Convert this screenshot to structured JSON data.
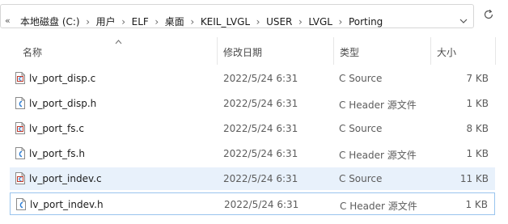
{
  "address_bar": {
    "overflow_glyph": "«",
    "separator": "›",
    "crumbs": [
      "本地磁盘 (C:)",
      "用户",
      "ELF",
      "桌面",
      "KEIL_LVGL",
      "USER",
      "LVGL",
      "Porting"
    ]
  },
  "columns": {
    "name": "名称",
    "date": "修改日期",
    "type": "类型",
    "size": "大小",
    "sorted_by": "名称"
  },
  "files": [
    {
      "name": "lv_port_disp.c",
      "date": "2022/5/24 6:31",
      "type": "C Source",
      "size": "7 KB",
      "icon": "c-source-file-icon"
    },
    {
      "name": "lv_port_disp.h",
      "date": "2022/5/24 6:31",
      "type": "C Header 源文件",
      "size": "1 KB",
      "icon": "c-header-file-icon"
    },
    {
      "name": "lv_port_fs.c",
      "date": "2022/5/24 6:31",
      "type": "C Source",
      "size": "8 KB",
      "icon": "c-source-file-icon"
    },
    {
      "name": "lv_port_fs.h",
      "date": "2022/5/24 6:31",
      "type": "C Header 源文件",
      "size": "1 KB",
      "icon": "c-header-file-icon"
    },
    {
      "name": "lv_port_indev.c",
      "date": "2022/5/24 6:31",
      "type": "C Source",
      "size": "11 KB",
      "icon": "c-source-file-icon"
    },
    {
      "name": "lv_port_indev.h",
      "date": "2022/5/24 6:31",
      "type": "C Header 源文件",
      "size": "1 KB",
      "icon": "c-header-file-icon"
    }
  ],
  "selected_row": 4,
  "focused_row": 5,
  "colors": {
    "selection": "#e8f1fb",
    "focus_border": "#99c4ee",
    "icon_blue": "#2b7cd3"
  }
}
